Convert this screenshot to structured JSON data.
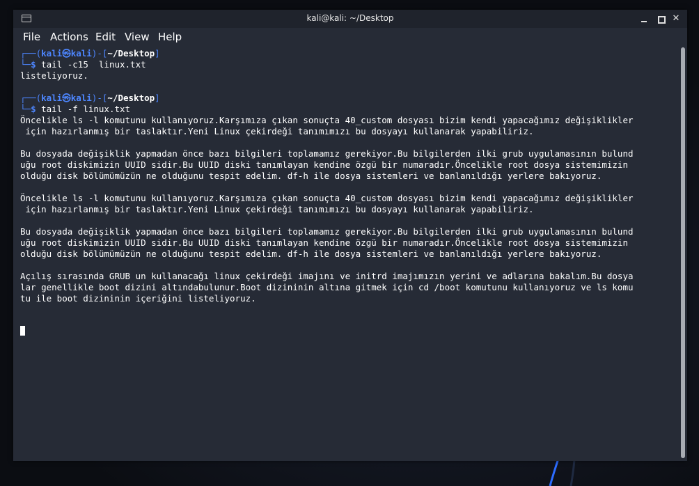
{
  "window": {
    "title": "kali@kali: ~/Desktop",
    "minimize_symbol": "",
    "close_symbol": "✕"
  },
  "menu": {
    "file": "File",
    "actions": "Actions",
    "edit": "Edit",
    "view": "View",
    "help": "Help"
  },
  "prompt": {
    "corner_top": "┌──(",
    "user": "kali",
    "at": "㉿",
    "host": "kali",
    "mid": ")-[",
    "path": "~/Desktop",
    "close": "]",
    "corner_bottom": "└─",
    "dollar": "$ "
  },
  "commands": {
    "cmd1": "tail -c15  linux.txt",
    "cmd2": "tail -f linux.txt"
  },
  "output": {
    "out1": "listeliyoruz.",
    "lines": [
      "Öncelikle ls -l komutunu kullanıyoruz.Karşımıza çıkan sonuçta 40_custom dosyası bizim kendi yapacağımız değişiklikler",
      " için hazırlanmış bir taslaktır.Yeni Linux çekirdeği tanımımızı bu dosyayı kullanarak yapabiliriz.",
      "",
      "Bu dosyada değişiklik yapmadan önce bazı bilgileri toplamamız gerekiyor.Bu bilgilerden ilki grub uygulamasının bulund",
      "uğu root diskimizin UUID sidir.Bu UUID diski tanımlayan kendine özgü bir numaradır.Öncelikle root dosya sistemimizin",
      "olduğu disk bölümümüzün ne olduğunu tespit edelim. df-h ile dosya sistemleri ve banlanıldığı yerlere bakıyoruz.",
      "",
      "Öncelikle ls -l komutunu kullanıyoruz.Karşımıza çıkan sonuçta 40_custom dosyası bizim kendi yapacağımız değişiklikler",
      " için hazırlanmış bir taslaktır.Yeni Linux çekirdeği tanımımızı bu dosyayı kullanarak yapabiliriz.",
      "",
      "Bu dosyada değişiklik yapmadan önce bazı bilgileri toplamamız gerekiyor.Bu bilgilerden ilki grub uygulamasının bulund",
      "uğu root diskimizin UUID sidir.Bu UUID diski tanımlayan kendine özgü bir numaradır.Öncelikle root dosya sistemimizin",
      "olduğu disk bölümümüzün ne olduğunu tespit edelim. df-h ile dosya sistemleri ve banlanıldığı yerlere bakıyoruz.",
      "",
      "Açılış sırasında GRUB un kullanacağı linux çekirdeği imajını ve initrd imajımızın yerini ve adlarına bakalım.Bu dosya",
      "lar genellikle boot dizini altındabulunur.Boot dizininin altına gitmek için cd /boot komutunu kullanıyoruz ve ls komu",
      "tu ile boot dizininin içeriğini listeliyoruz."
    ]
  },
  "colors": {
    "prompt_accent": "#4d86ff",
    "terminal_bg": "#262b36",
    "text": "#ffffff"
  }
}
